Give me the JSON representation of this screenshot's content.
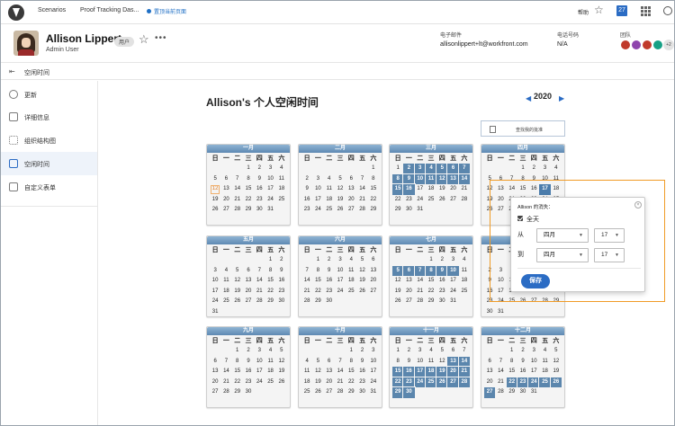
{
  "top_nav": {
    "links": [
      "Scenarios",
      "Proof Tracking Das..."
    ],
    "quick_link": "置顶当前页面",
    "help": "帮助",
    "calendar_badge": "27"
  },
  "user": {
    "name": "Allison Lippert",
    "role": "Admin User",
    "badge": "用户",
    "more": "•••",
    "email_label": "电子邮件",
    "email": "allisonlippert+lt@workfront.com",
    "phone_label": "电话号码",
    "phone": "N/A",
    "team_label": "团队",
    "team_more": "+2"
  },
  "breadcrumb": {
    "title": "空闲时间"
  },
  "sidebar": {
    "items": [
      {
        "label": "更新",
        "icon": "chat-icon"
      },
      {
        "label": "详细信息",
        "icon": "details-icon"
      },
      {
        "label": "组织结构图",
        "icon": "org-chart-icon"
      },
      {
        "label": "空闲时间",
        "icon": "calendar-icon"
      },
      {
        "label": "自定义表单",
        "icon": "form-icon"
      }
    ]
  },
  "main": {
    "title": "Allison's 个人空闲时间",
    "year": "2020",
    "find_button": "查找我的批准",
    "weekdays": [
      "日",
      "一",
      "二",
      "三",
      "四",
      "五",
      "六"
    ]
  },
  "months": [
    {
      "name": "一月",
      "start": 3,
      "days": 31,
      "off": [],
      "today": [
        12
      ],
      "picked": []
    },
    {
      "name": "二月",
      "start": 6,
      "days": 29,
      "off": [],
      "today": [],
      "picked": []
    },
    {
      "name": "三月",
      "start": 0,
      "days": 31,
      "off": [
        2,
        3,
        4,
        5,
        6,
        7,
        8,
        9,
        10,
        11,
        12,
        13,
        14,
        15,
        16
      ],
      "today": [],
      "picked": []
    },
    {
      "name": "四月",
      "start": 3,
      "days": 30,
      "off": [],
      "today": [],
      "picked": [
        17
      ]
    },
    {
      "name": "五月",
      "start": 5,
      "days": 31,
      "off": [],
      "today": [],
      "picked": []
    },
    {
      "name": "六月",
      "start": 1,
      "days": 30,
      "off": [],
      "today": [],
      "picked": []
    },
    {
      "name": "七月",
      "start": 3,
      "days": 31,
      "off": [
        5,
        6,
        7,
        8,
        9,
        10
      ],
      "today": [],
      "picked": []
    },
    {
      "name": "八月",
      "start": 6,
      "days": 31,
      "off": [],
      "today": [],
      "picked": []
    },
    {
      "name": "九月",
      "start": 2,
      "days": 30,
      "off": [],
      "today": [],
      "picked": []
    },
    {
      "name": "十月",
      "start": 4,
      "days": 31,
      "off": [],
      "today": [],
      "picked": []
    },
    {
      "name": "十一月",
      "start": 0,
      "days": 30,
      "off": [
        13,
        14,
        15,
        16,
        17,
        18,
        19,
        20,
        21,
        22,
        23,
        24,
        25,
        26,
        27,
        28,
        29,
        30
      ],
      "today": [],
      "picked": []
    },
    {
      "name": "十二月",
      "start": 2,
      "days": 31,
      "off": [
        22,
        23,
        24,
        25,
        26,
        27
      ],
      "today": [],
      "picked": []
    }
  ],
  "popup": {
    "title": "Allison 的消失：",
    "all_day_label": "全天",
    "all_day_checked": true,
    "from_label": "从",
    "to_label": "到",
    "from_month": "四月",
    "from_day": "17",
    "to_month": "四月",
    "to_day": "17",
    "save": "保存",
    "close": "×"
  },
  "colors": {
    "accent": "#2b6cc4",
    "off_day": "#5b86ad",
    "highlight": "#f09b26",
    "team_avatars": [
      "#c0392b",
      "#8e44ad",
      "#c0392b",
      "#16a085"
    ]
  }
}
